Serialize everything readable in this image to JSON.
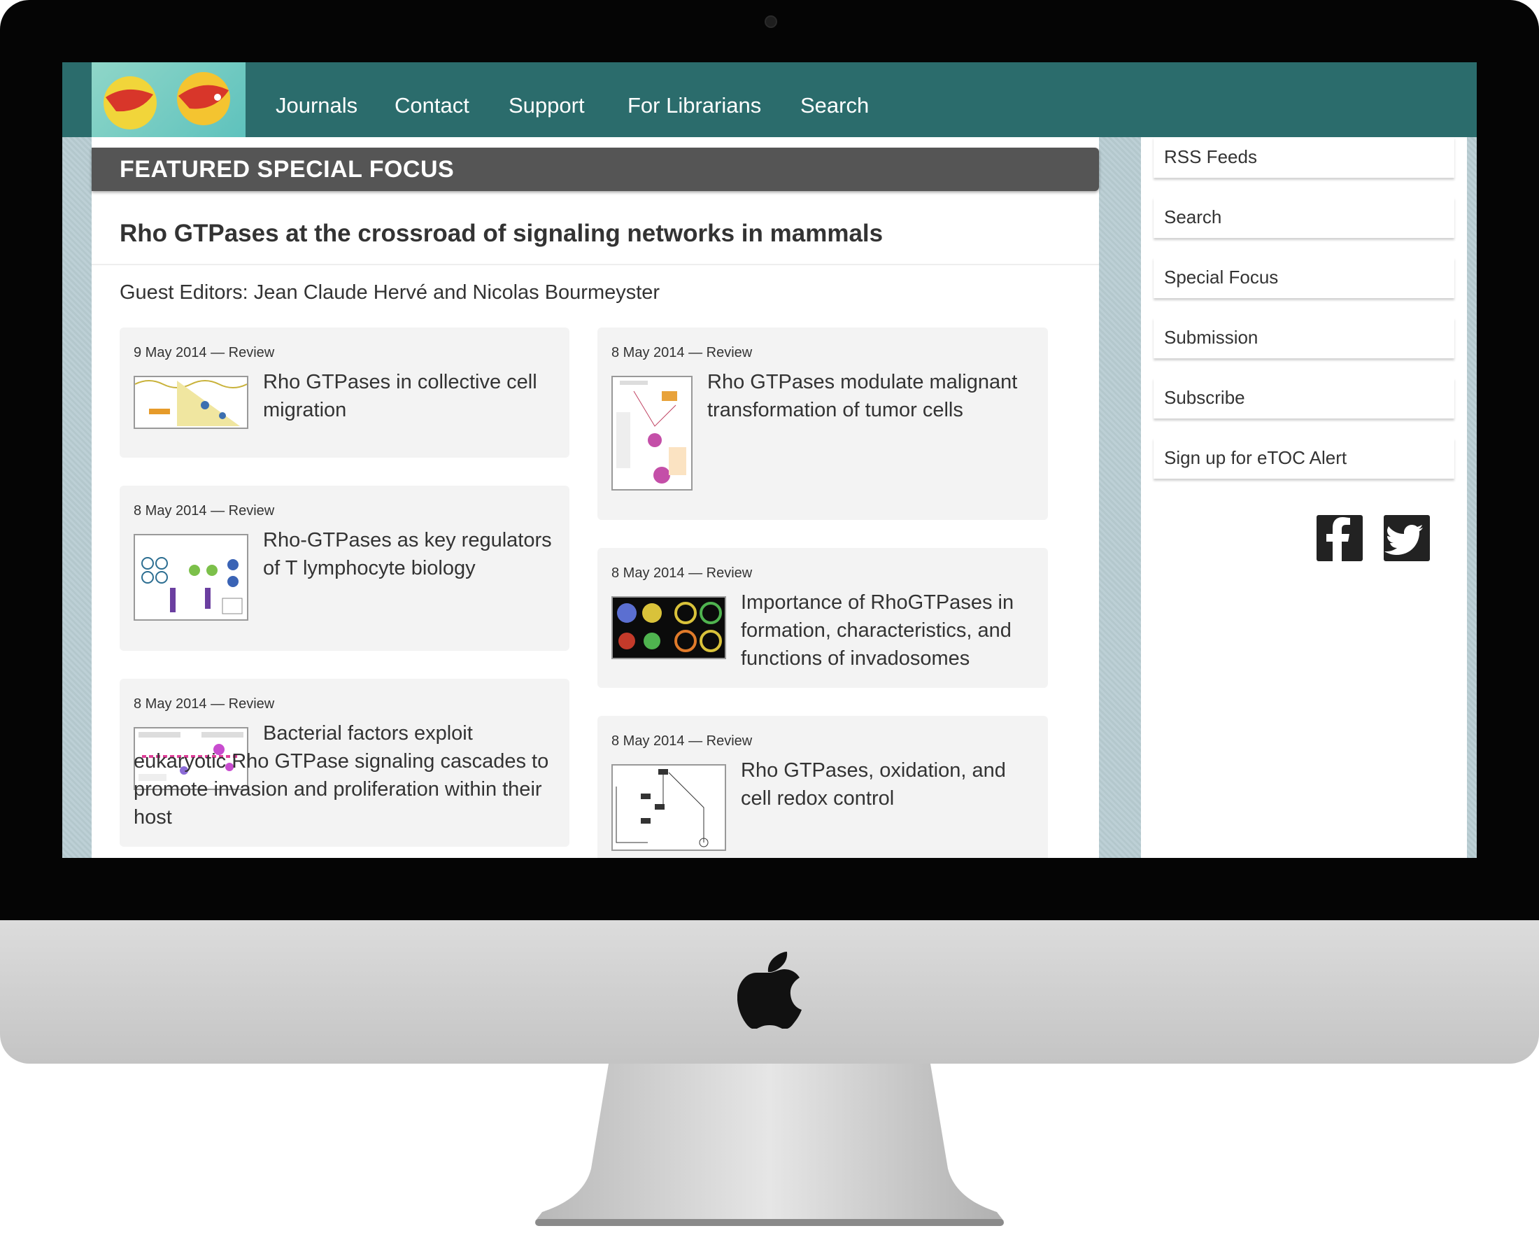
{
  "nav": {
    "items": [
      "Journals",
      "Contact",
      "Support",
      "For Librarians",
      "Search"
    ]
  },
  "featured": {
    "heading": "FEATURED SPECIAL FOCUS",
    "title": "Rho GTPases at the crossroad of signaling networks in mammals",
    "editors": "Guest Editors: Jean Claude Hervé and Nicolas Bourmeyster"
  },
  "articles": [
    {
      "meta": "9 May 2014 — Review",
      "title": "Rho GTPases in collective cell migration"
    },
    {
      "meta": "8 May 2014 — Review",
      "title": "Rho-GTPases as key regulators of T lymphocyte biology"
    },
    {
      "meta": "8 May 2014 — Review",
      "title": "Bacterial factors exploit eukaryotic Rho GTPase signaling cascades to promote invasion and proliferation within their host"
    },
    {
      "meta": "8 May 2014 — Review",
      "title": "Rho GTPases modulate malignant transformation of tumor cells"
    },
    {
      "meta": "8 May 2014 — Review",
      "title": "Importance of RhoGTPases in formation, characteristics, and functions of invadosomes"
    },
    {
      "meta": "8 May 2014 — Review",
      "title": "Rho GTPases, oxidation, and cell redox control"
    }
  ],
  "sidebar": {
    "links": [
      "RSS Feeds",
      "Search",
      "Special Focus",
      "Submission",
      "Subscribe",
      "Sign up for eTOC Alert"
    ]
  },
  "social": {
    "icons": [
      "facebook-icon",
      "twitter-icon"
    ]
  },
  "colors": {
    "nav": "#2b6c6c",
    "featured_bar": "#555555",
    "card": "#f3f3f3"
  }
}
